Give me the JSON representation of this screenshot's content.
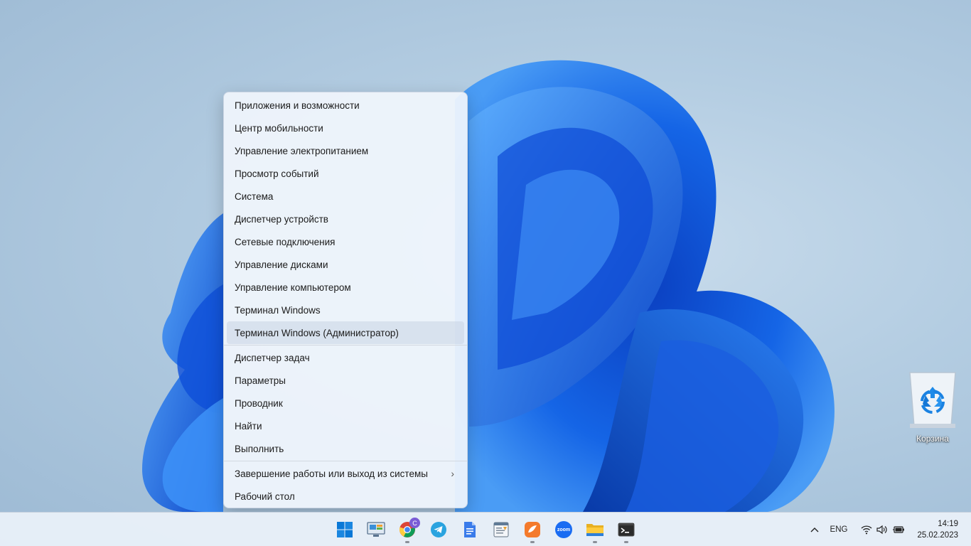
{
  "menu": {
    "group1": [
      {
        "label": "Приложения и возможности"
      },
      {
        "label": "Центр мобильности"
      },
      {
        "label": "Управление электропитанием"
      },
      {
        "label": "Просмотр событий"
      },
      {
        "label": "Система"
      },
      {
        "label": "Диспетчер устройств"
      },
      {
        "label": "Сетевые подключения"
      },
      {
        "label": "Управление дисками"
      },
      {
        "label": "Управление компьютером"
      },
      {
        "label": "Терминал Windows"
      },
      {
        "label": "Терминал Windows (Администратор)"
      }
    ],
    "group2": [
      {
        "label": "Диспетчер задач"
      },
      {
        "label": "Параметры"
      },
      {
        "label": "Проводник"
      },
      {
        "label": "Найти"
      },
      {
        "label": "Выполнить"
      }
    ],
    "group3": [
      {
        "label": "Завершение работы или выход из системы",
        "submenu": true,
        "chevron": "›"
      },
      {
        "label": "Рабочий стол"
      }
    ]
  },
  "desktop": {
    "recycle_bin_label": "Корзина"
  },
  "taskbar": {
    "apps": [
      {
        "name": "start",
        "icon": "windows-logo-icon"
      },
      {
        "name": "desktop-app",
        "icon": "monitor-app-icon"
      },
      {
        "name": "chrome",
        "icon": "chrome-icon",
        "badge": "C"
      },
      {
        "name": "telegram",
        "icon": "telegram-icon"
      },
      {
        "name": "docs",
        "icon": "document-icon"
      },
      {
        "name": "editor",
        "icon": "text-editor-icon"
      },
      {
        "name": "bird-app",
        "icon": "bird-app-icon"
      },
      {
        "name": "zoom",
        "icon": "zoom-icon",
        "label": "zoom"
      },
      {
        "name": "file-explorer",
        "icon": "folder-icon"
      },
      {
        "name": "terminal",
        "icon": "terminal-icon"
      }
    ],
    "tray": {
      "language": "ENG",
      "time": "14:19",
      "date": "25.02.2023"
    }
  },
  "colors": {
    "accent": "#0067c0",
    "wallpaper_blue": "#1a6fe8",
    "menu_bg": "#f0f5fc"
  }
}
